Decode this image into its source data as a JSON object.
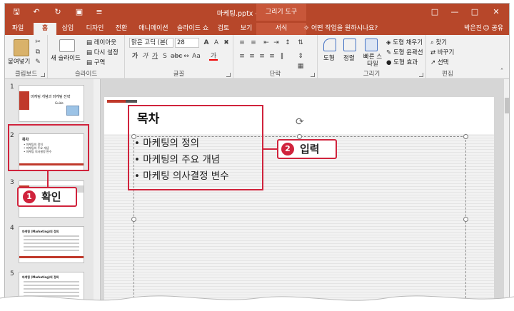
{
  "window": {
    "title": "마케팅.pptx - PowerPoint",
    "context_title": "그리기 도구"
  },
  "tabs": [
    "파일",
    "홈",
    "삽입",
    "디자인",
    "전환",
    "애니메이션",
    "슬라이드 쇼",
    "검토",
    "보기",
    "서식"
  ],
  "active_tab": "홈",
  "tell_me": "어떤 작업을 원하시나요?",
  "user": "박은진",
  "share": "공유",
  "ribbon": {
    "clipboard": {
      "label": "클립보드",
      "paste": "붙여넣기"
    },
    "slides": {
      "label": "슬라이드",
      "new_slide": "새 슬라이드",
      "layout": "레이아웃",
      "reset": "다시 설정",
      "section": "구역"
    },
    "font": {
      "label": "글꼴",
      "font_name": "맑은 고딕 (본(",
      "font_size": "28"
    },
    "paragraph": {
      "label": "단락"
    },
    "drawing": {
      "label": "그리기",
      "shape": "도형",
      "arrange": "정렬",
      "quick_styles": "빠른 스타일",
      "fill": "도형 채우기",
      "outline": "도형 윤곽선",
      "effects": "도형 효과"
    },
    "editing": {
      "label": "편집",
      "find": "찾기",
      "replace": "바꾸기",
      "select": "선택"
    }
  },
  "thumbnails": [
    {
      "number": "1",
      "title": "마케팅 개념과 마케팅 전략",
      "sub": "Guide"
    },
    {
      "number": "2",
      "title": "목차"
    },
    {
      "number": "3"
    },
    {
      "number": "4",
      "title": "마케팅 (Marketing)의 정의"
    },
    {
      "number": "5",
      "title": "마케팅 (Marketing)의 정의"
    }
  ],
  "slide": {
    "title": "목차",
    "bullets": [
      "마케팅의 정의",
      "마케팅의 주요 개념",
      "마케팅 의사결정 변수"
    ]
  },
  "annotations": {
    "step1": {
      "number": "1",
      "label": "확인"
    },
    "step2": {
      "number": "2",
      "label": "입력"
    },
    "color": "#d0233c"
  }
}
